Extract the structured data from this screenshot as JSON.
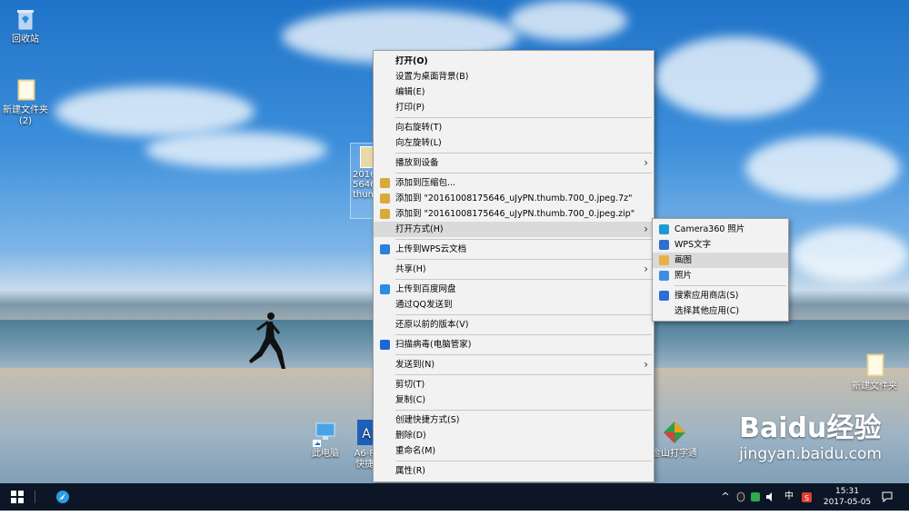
{
  "desktop": {
    "icons": [
      {
        "id": "recycle",
        "label": "回收站"
      },
      {
        "id": "folder-left",
        "label": "新建文件夹 (2)"
      },
      {
        "id": "folder-right",
        "label": "新建文件夹"
      },
      {
        "id": "this-pc",
        "label": "此电脑"
      },
      {
        "id": "a6",
        "label": "A6-P\n快捷"
      },
      {
        "id": "jinshan",
        "label": "金山打字通"
      }
    ],
    "selected_file_label": "2016\n5646\nthum",
    "watermark": {
      "brand": "Baidu经验",
      "url": "jingyan.baidu.com"
    }
  },
  "context_menu": {
    "groups": [
      [
        {
          "label": "打开(O)",
          "bold": true
        },
        {
          "label": "设置为桌面背景(B)"
        },
        {
          "label": "编辑(E)"
        },
        {
          "label": "打印(P)"
        }
      ],
      [
        {
          "label": "向右旋转(T)"
        },
        {
          "label": "向左旋转(L)"
        }
      ],
      [
        {
          "label": "播放到设备",
          "submenu": true
        }
      ],
      [
        {
          "label": "添加到压缩包...",
          "icon": "archive-icon"
        },
        {
          "label": "添加到 \"20161008175646_uJyPN.thumb.700_0.jpeg.7z\"",
          "icon": "archive-icon"
        },
        {
          "label": "添加到 \"20161008175646_uJyPN.thumb.700_0.jpeg.zip\"",
          "icon": "archive-icon"
        },
        {
          "label": "打开方式(H)",
          "submenu": true,
          "highlighted": true
        }
      ],
      [
        {
          "label": "上传到WPS云文档",
          "icon": "wps-cloud-icon"
        }
      ],
      [
        {
          "label": "共享(H)",
          "submenu": true
        }
      ],
      [
        {
          "label": "上传到百度网盘",
          "icon": "baidu-netdisk-icon"
        },
        {
          "label": "通过QQ发送到"
        }
      ],
      [
        {
          "label": "还原以前的版本(V)"
        }
      ],
      [
        {
          "label": "扫描病毒(电脑管家)",
          "icon": "shield-icon"
        }
      ],
      [
        {
          "label": "发送到(N)",
          "submenu": true
        }
      ],
      [
        {
          "label": "剪切(T)"
        },
        {
          "label": "复制(C)"
        }
      ],
      [
        {
          "label": "创建快捷方式(S)"
        },
        {
          "label": "删除(D)"
        },
        {
          "label": "重命名(M)"
        }
      ],
      [
        {
          "label": "属性(R)"
        }
      ]
    ]
  },
  "open_with_submenu": {
    "groups": [
      [
        {
          "label": "Camera360 照片",
          "icon": "camera-icon"
        },
        {
          "label": "WPS文字",
          "icon": "wps-writer-icon"
        },
        {
          "label": "画图",
          "icon": "paint-icon",
          "highlighted": true
        },
        {
          "label": "照片",
          "icon": "photos-icon"
        }
      ],
      [
        {
          "label": "搜索应用商店(S)",
          "icon": "store-icon"
        },
        {
          "label": "选择其他应用(C)"
        }
      ]
    ]
  },
  "taskbar": {
    "tray_ime": "中",
    "time": "15:31",
    "date": "2017-05-05"
  },
  "colors": {
    "accent": "#1e6fd9",
    "taskbar": "#0c1626",
    "menu_bg": "#f2f2f2",
    "menu_highlight": "#dadada"
  }
}
